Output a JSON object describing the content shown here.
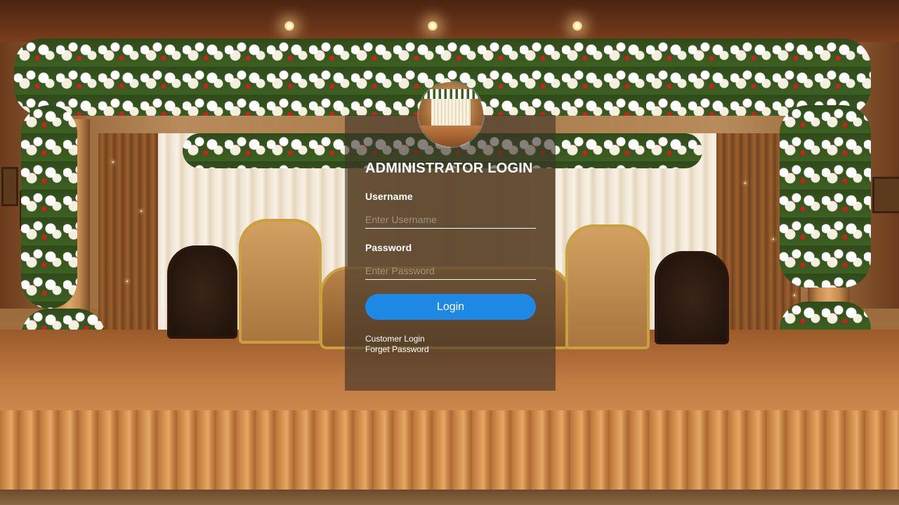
{
  "login": {
    "title": "ADMINISTRATOR LOGIN",
    "username_label": "Username",
    "username_placeholder": "Enter Username",
    "password_label": "Password",
    "password_placeholder": "Enter Password",
    "button_label": "Login",
    "customer_login_link": "Customer Login",
    "forget_password_link": "Forget Password",
    "button_color": "#1e88e5"
  }
}
